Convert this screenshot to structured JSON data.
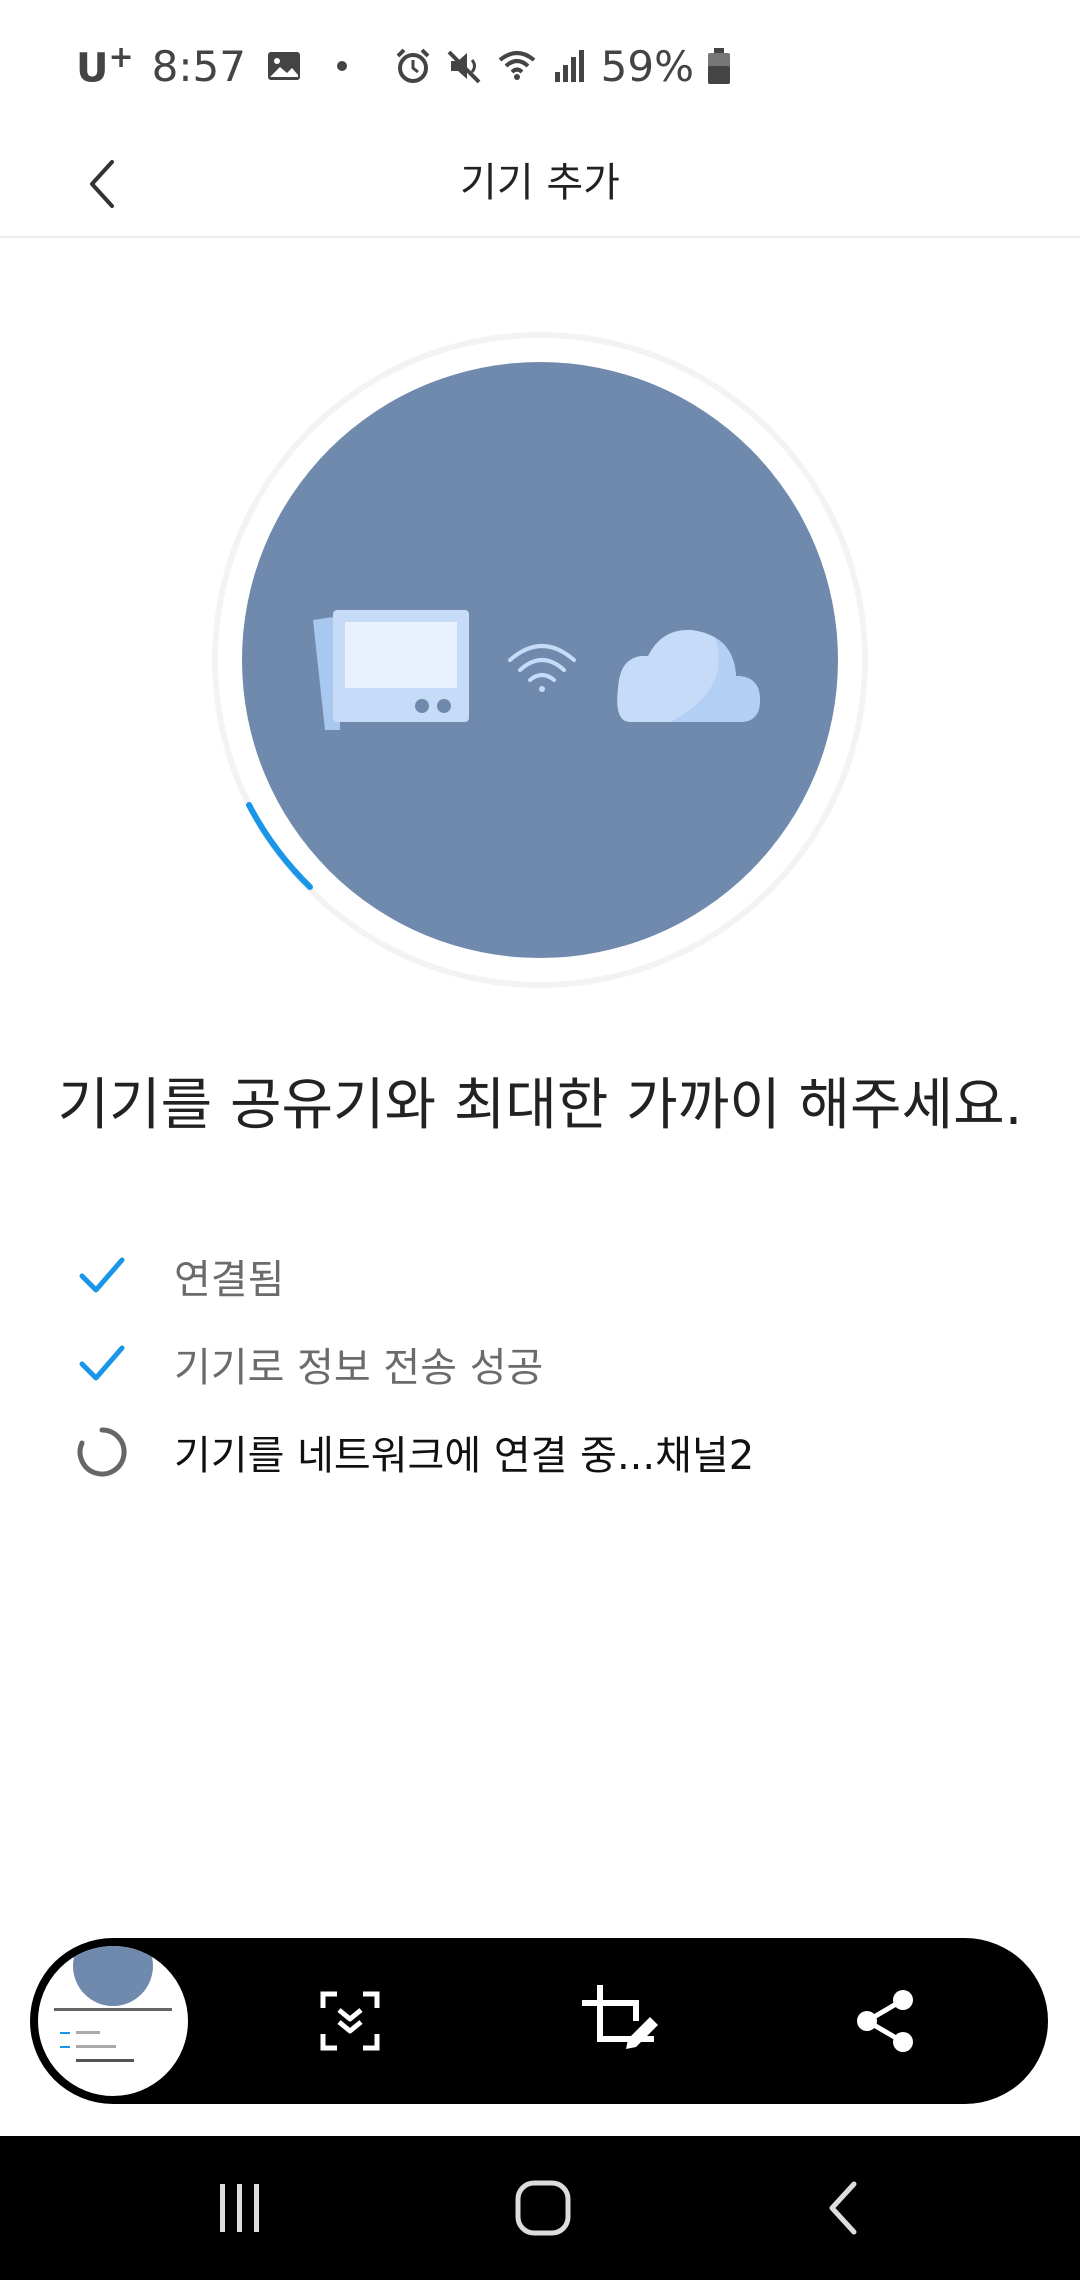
{
  "status_bar": {
    "carrier": "U",
    "carrier_sup": "+",
    "time": "8:57",
    "battery": "59%"
  },
  "header": {
    "title": "기기 추가"
  },
  "main": {
    "instruction": "기기를 공유기와 최대한 가까이 해주세요.",
    "steps": [
      {
        "label": "연결됨",
        "state": "done"
      },
      {
        "label": "기기로 정보 전송 성공",
        "state": "done"
      },
      {
        "label": "기기를 네트워크에 연결 중...채널2",
        "state": "in-progress"
      }
    ]
  },
  "colors": {
    "accent": "#1a96e8",
    "circle": "#6f8aad",
    "device": "#c5dbf7",
    "toolbar": "#000000"
  },
  "toolbar": {
    "icons": [
      "scroll-capture-icon",
      "crop-edit-icon",
      "share-icon"
    ]
  },
  "navbar": {
    "icons": [
      "recent-apps-icon",
      "home-icon",
      "back-icon"
    ]
  }
}
